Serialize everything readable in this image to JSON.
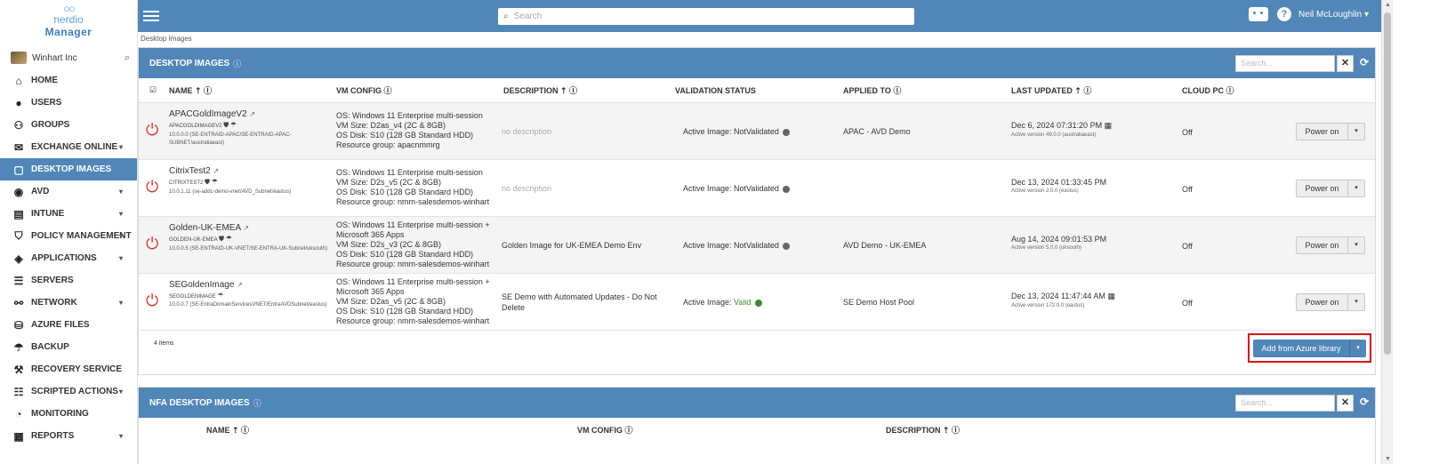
{
  "app": {
    "logo_text": "nerdio",
    "logo_sub": "Manager",
    "tenant": "Winhart Inc"
  },
  "topbar": {
    "search_placeholder": "Search",
    "user_name": "Neil McLoughlin",
    "help_glyph": "?"
  },
  "sidebar": {
    "items": [
      {
        "label": "HOME",
        "icon": "home-icon",
        "caret": false,
        "active": false
      },
      {
        "label": "USERS",
        "icon": "user-icon",
        "caret": false,
        "active": false
      },
      {
        "label": "GROUPS",
        "icon": "groups-icon",
        "caret": false,
        "active": false
      },
      {
        "label": "EXCHANGE ONLINE",
        "icon": "envelope-icon",
        "caret": true,
        "active": false
      },
      {
        "label": "DESKTOP IMAGES",
        "icon": "desktop-images-icon",
        "caret": false,
        "active": true
      },
      {
        "label": "AVD",
        "icon": "avd-icon",
        "caret": true,
        "active": false
      },
      {
        "label": "INTUNE",
        "icon": "intune-icon",
        "caret": true,
        "active": false
      },
      {
        "label": "POLICY MANAGEMENT",
        "icon": "shield-icon",
        "caret": true,
        "active": false
      },
      {
        "label": "APPLICATIONS",
        "icon": "box-icon",
        "caret": true,
        "active": false
      },
      {
        "label": "SERVERS",
        "icon": "server-icon",
        "caret": false,
        "active": false
      },
      {
        "label": "NETWORK",
        "icon": "network-icon",
        "caret": true,
        "active": false
      },
      {
        "label": "AZURE FILES",
        "icon": "database-icon",
        "caret": false,
        "active": false
      },
      {
        "label": "BACKUP",
        "icon": "umbrella-icon",
        "caret": false,
        "active": false
      },
      {
        "label": "RECOVERY SERVICE",
        "icon": "hammer-icon",
        "caret": false,
        "active": false
      },
      {
        "label": "SCRIPTED ACTIONS",
        "icon": "list-icon",
        "caret": true,
        "active": false
      },
      {
        "label": "MONITORING",
        "icon": "gauge-icon",
        "caret": false,
        "active": false
      },
      {
        "label": "REPORTS",
        "icon": "report-icon",
        "caret": true,
        "active": false
      }
    ]
  },
  "breadcrumb": "Desktop Images",
  "desktop_images": {
    "title": "DESKTOP IMAGES",
    "search_placeholder": "Search...",
    "columns": {
      "name": "NAME",
      "vm_config": "VM CONFIG",
      "description": "DESCRIPTION",
      "validation": "VALIDATION STATUS",
      "applied_to": "APPLIED TO",
      "last_updated": "LAST UPDATED",
      "cloud_pc": "CLOUD PC"
    },
    "rows": [
      {
        "name": "APACGoldImageV2",
        "sub": "APACGOLDIMAGEV2",
        "subnet": "10.0.0.0 (SE-ENTRAID-APAC/SE-ENTRAID-APAC-SUBNET/australiaeast)",
        "vm_config": [
          "OS: Windows 11 Enterprise multi-session",
          "VM Size: D2as_v4 (2C & 8GB)",
          "OS Disk: S10 (128 GB Standard HDD)",
          "Resource group: apacnmmrg"
        ],
        "description": "no description",
        "validation_prefix": "Active Image: ",
        "validation_state": "NotValidated",
        "applied_to": "APAC - AVD Demo",
        "last_updated": "Dec 6, 2024 07:31:20 PM",
        "version": "Active version 49.0.0 (australiaeast)",
        "cloud_pc": "Off",
        "power_label": "Power on"
      },
      {
        "name": "CitrixTest2",
        "sub": "CITRIXTEST2",
        "subnet": "10.0.1.11 (se-addc-demo-vnet/AVD_Subnet/eastus)",
        "vm_config": [
          "OS: Windows 11 Enterprise multi-session",
          "VM Size: D2s_v5 (2C & 8GB)",
          "OS Disk: S10 (128 GB Standard HDD)",
          "Resource group: nmm-salesdemos-winhart"
        ],
        "description": "no description",
        "validation_prefix": "Active Image: ",
        "validation_state": "NotValidated",
        "applied_to": "",
        "last_updated": "Dec 13, 2024 01:33:45 PM",
        "version": "Active version 2.0.0 (eastus)",
        "cloud_pc": "Off",
        "power_label": "Power on"
      },
      {
        "name": "Golden-UK-EMEA",
        "sub": "GOLDEN-UK-EMEA",
        "subnet": "10.0.0.5 (SE-ENTRAID-UK-VNET/SE-ENTRA-UK-Subnet/uksouth)",
        "vm_config": [
          "OS: Windows 11 Enterprise multi-session + Microsoft 365 Apps",
          "VM Size: D2s_v3 (2C & 8GB)",
          "OS Disk: S10 (128 GB Standard HDD)",
          "Resource group: nmm-salesdemos-winhart"
        ],
        "description": "Golden Image for UK-EMEA Demo Env",
        "validation_prefix": "Active Image: ",
        "validation_state": "NotValidated",
        "applied_to": "AVD Demo - UK-EMEA",
        "last_updated": "Aug 14, 2024 09:01:53 PM",
        "version": "Active version 5.0.0 (uksouth)",
        "cloud_pc": "Off",
        "power_label": "Power on"
      },
      {
        "name": "SEGoldenImage",
        "sub": "SEGOLDENIMAGE",
        "subnet": "10.0.0.7 (SE-EntraDomainServicesVNET/EntraAVDSubnet/eastus)",
        "vm_config": [
          "OS: Windows 11 Enterprise multi-session + Microsoft 365 Apps",
          "VM Size: D2as_v5 (2C & 8GB)",
          "OS Disk: S10 (128 GB Standard HDD)",
          "Resource group: nmm-salesdemos-winhart"
        ],
        "description": "SE Demo with Automated Updates - Do Not Delete",
        "validation_prefix": "Active Image: ",
        "validation_state": "Valid",
        "applied_to": "SE Demo Host Pool",
        "last_updated": "Dec 13, 2024 11:47:44 AM",
        "version": "Active version 172.0.0 (eastus)",
        "cloud_pc": "Off",
        "power_label": "Power on"
      }
    ],
    "items_count": "4 items",
    "add_button": "Add from Azure library"
  },
  "nfa_images": {
    "title": "NFA DESKTOP IMAGES",
    "search_placeholder": "Search...",
    "columns": {
      "name": "NAME",
      "vm_config": "VM CONFIG",
      "description": "DESCRIPTION"
    }
  },
  "colors": {
    "primary": "#5186b8",
    "power_red": "#d73a2e",
    "valid_green": "#3a8a2e",
    "highlight_red": "#d8101a"
  }
}
